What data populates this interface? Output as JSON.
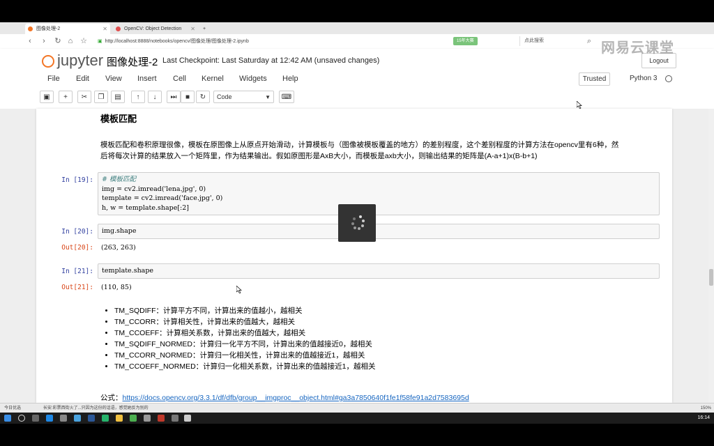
{
  "browser": {
    "tabs": [
      {
        "label": "图像处理-2",
        "active": true
      },
      {
        "label": "OpenCV: Object Detection",
        "active": false
      }
    ],
    "new_tab": "+",
    "url": "http://localhost:8888/notebooks/opencv/图像处理/图像处理-2.ipynb",
    "badge": "15年大赛",
    "search_placeholder": "点此搜索",
    "logo_letter": "e"
  },
  "jupyter": {
    "logo_text": "jupyter",
    "notebook_title": "图像处理-2",
    "checkpoint": "Last Checkpoint: Last Saturday at 12:42 AM (unsaved changes)",
    "logout": "Logout",
    "menus": [
      "File",
      "Edit",
      "View",
      "Insert",
      "Cell",
      "Kernel",
      "Widgets",
      "Help"
    ],
    "trusted": "Trusted",
    "kernel": "Python 3",
    "cell_type": "Code"
  },
  "notebook": {
    "heading": "模板匹配",
    "intro": "模板匹配和卷积原理很像，模板在原图像上从原点开始滑动，计算模板与（图像被模板覆盖的地方）的差别程度，这个差别程度的计算方法在opencv里有6种，然后将每次计算的结果放入一个矩阵里，作为结果输出。假如原图形是AxB大小，而模板是axb大小，则输出结果的矩阵是(A-a+1)x(B-b+1)",
    "intro_line1": "模板匹配和卷积原理很像，模板在原图像上从原点开始滑动，计算模板与（图像被模板覆盖的地方）的差别程度，这个差别程度的计算方法在opencv里有6种，然",
    "intro_line2": "后将每次计算的结果放入一个矩阵里，作为结果输出。假如原图形是AxB大小，而模板是axb大小，则输出结果的矩阵是(A-a+1)x(B-b+1)",
    "cells": [
      {
        "prompt": "In [19]:",
        "code": [
          "# 模板匹配",
          "img = cv2.imread('lena.jpg', 0)",
          "template = cv2.imread('face.jpg', 0)",
          "h, w = template.shape[:2]"
        ]
      },
      {
        "prompt": "In [20]:",
        "code": [
          "img.shape"
        ],
        "out_prompt": "Out[20]:",
        "output": "(263, 263)"
      },
      {
        "prompt": "In [21]:",
        "code": [
          "template.shape"
        ],
        "out_prompt": "Out[21]:",
        "output": "(110, 85)"
      }
    ],
    "methods": [
      "TM_SQDIFF：计算平方不同，计算出来的值越小，越相关",
      "TM_CCORR：计算相关性，计算出来的值越大，越相关",
      "TM_CCOEFF：计算相关系数，计算出来的值越大，越相关",
      "TM_SQDIFF_NORMED：计算归一化平方不同，计算出来的值越接近0，越相关",
      "TM_CCORR_NORMED：计算归一化相关性，计算出来的值越接近1，越相关",
      "TM_CCOEFF_NORMED：计算归一化相关系数，计算出来的值越接近1，越相关"
    ],
    "formula_label": "公式：",
    "formula_link": "https://docs.opencv.org/3.3.1/df/dfb/group__imgproc__object.html#ga3a7850640f1fe1f58fe91a2d7583695d"
  },
  "status": {
    "left": "今日优选",
    "news": "长安:彩票西街火了...只因为这份的话语，感觉她反为别的",
    "zoom": "150%",
    "clock": "16:14"
  },
  "watermark": "网易云课堂"
}
